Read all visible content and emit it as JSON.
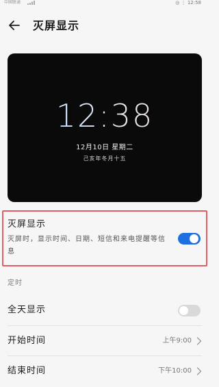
{
  "status_bar": {
    "carrier": "中国联通",
    "right": "◎ ⋮ 12:58"
  },
  "header": {
    "title": "灭屏显示"
  },
  "preview": {
    "time": "12:38",
    "date": "12月10日 星期二",
    "lunar": "己亥年冬月十五"
  },
  "aod_setting": {
    "title": "灭屏显示",
    "description": "灭屏时，显示时间、日期、短信和来电提醒等信息",
    "enabled": true
  },
  "schedule": {
    "section_label": "定时",
    "all_day": {
      "label": "全天显示",
      "enabled": false
    },
    "start_time": {
      "label": "开始时间",
      "value": "上午9:00"
    },
    "end_time": {
      "label": "结束时间",
      "value": "下午10:00"
    }
  },
  "colors": {
    "accent": "#1e6fe0",
    "highlight_border": "#e65a63",
    "background": "#f6f6f6"
  }
}
